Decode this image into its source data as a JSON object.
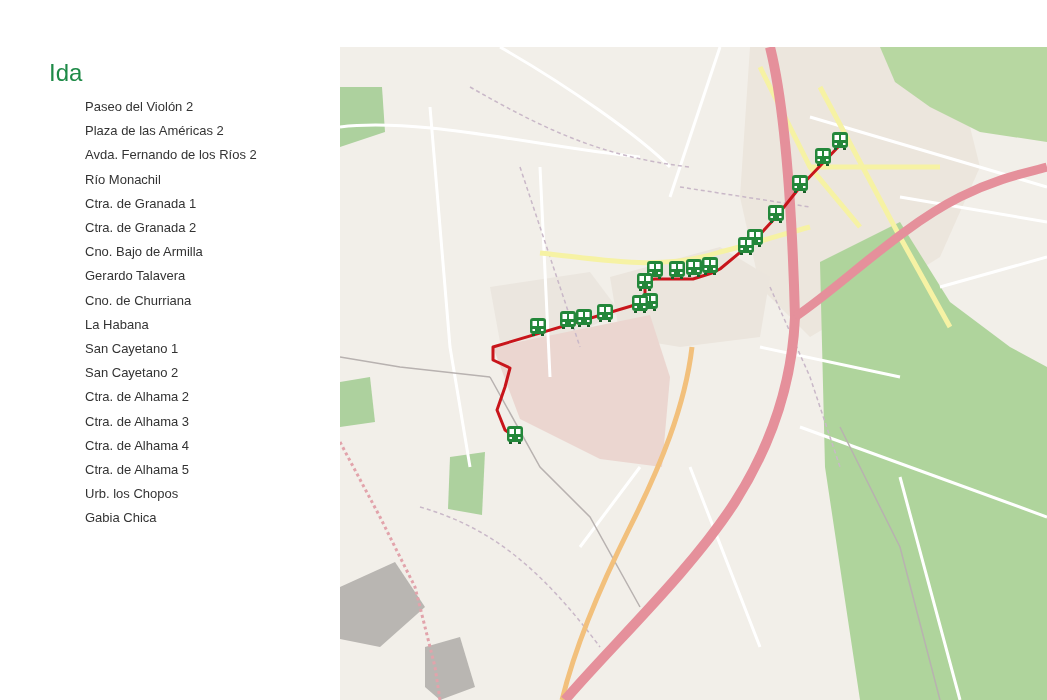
{
  "section": {
    "title": "Ida",
    "stops": [
      "Paseo del Violón 2",
      "Plaza de las Américas 2",
      "Avda. Fernando de los Ríos 2",
      "Río Monachil",
      "Ctra. de Granada 1",
      "Ctra. de Granada 2",
      "Cno. Bajo de Armilla",
      "Gerardo Talavera",
      "Cno. de Churriana",
      "La Habana",
      "San Cayetano 1",
      "San Cayetano 2",
      "Ctra. de Alhama 2",
      "Ctra. de Alhama 3",
      "Ctra. de Alhama 4",
      "Ctra. de Alhama 5",
      "Urb. los Chopos",
      "Gabia Chica"
    ]
  }
}
